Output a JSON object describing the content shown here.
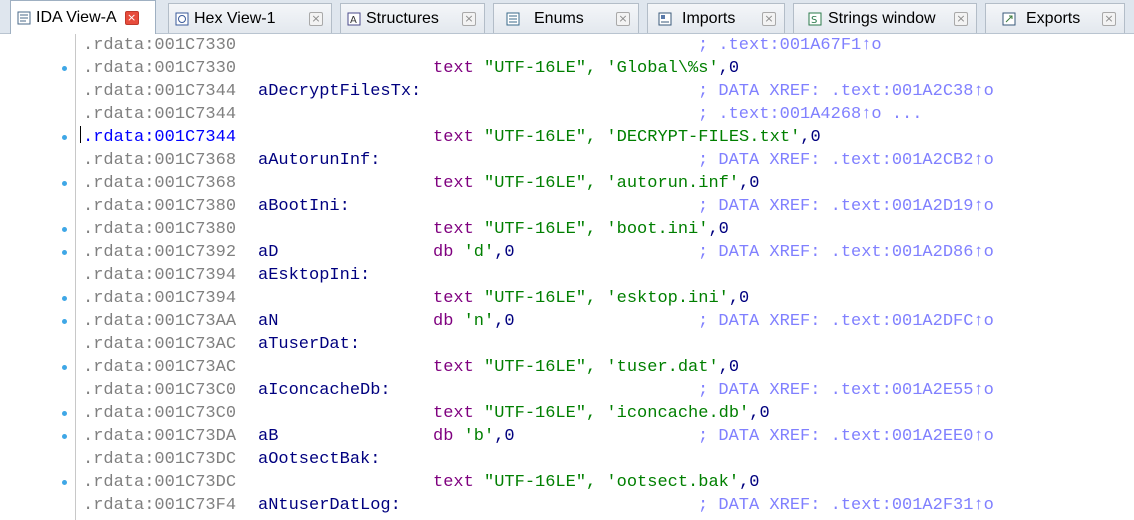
{
  "tabs": [
    {
      "label": "IDA View-A",
      "icon": "ida-view-icon",
      "active": true
    },
    {
      "label": "Hex View-1",
      "icon": "hex-view-icon",
      "active": false
    },
    {
      "label": "Structures",
      "icon": "structures-icon",
      "active": false
    },
    {
      "label": "Enums",
      "icon": "enums-icon",
      "active": false
    },
    {
      "label": "Imports",
      "icon": "imports-icon",
      "active": false
    },
    {
      "label": "Strings window",
      "icon": "strings-icon",
      "active": false
    },
    {
      "label": "Exports",
      "icon": "exports-icon",
      "active": false
    }
  ],
  "close_glyph": "×",
  "colors": {
    "address": "#808080",
    "current_address": "#0000ff",
    "name": "#00007f",
    "mnemonic": "#7f007f",
    "string": "#007f00",
    "comment": "#8080ff",
    "breakpoint_dot": "#3fa7e6"
  },
  "lines": [
    {
      "addr": ".rdata:001C7330",
      "name": "",
      "mnem": "",
      "str": "",
      "tail": "",
      "comment": "; .text:001A67F1↑o",
      "dot": false
    },
    {
      "addr": ".rdata:001C7330",
      "name": "",
      "mnem": "text ",
      "str": "\"UTF-16LE\", 'Global\\%s'",
      "tail": ",0",
      "comment": "",
      "dot": true
    },
    {
      "addr": ".rdata:001C7344",
      "name": "aDecryptFilesTx:",
      "mnem": "",
      "str": "",
      "tail": "",
      "comment": "; DATA XREF: .text:001A2C38↑o",
      "dot": false
    },
    {
      "addr": ".rdata:001C7344",
      "name": "",
      "mnem": "",
      "str": "",
      "tail": "",
      "comment": "; .text:001A4268↑o ...",
      "dot": false
    },
    {
      "addr": ".rdata:001C7344",
      "name": "",
      "mnem": "text ",
      "str": "\"UTF-16LE\", 'DECRYPT-FILES.txt'",
      "tail": ",0",
      "comment": "",
      "dot": true,
      "current": true
    },
    {
      "addr": ".rdata:001C7368",
      "name": "aAutorunInf:",
      "mnem": "",
      "str": "",
      "tail": "",
      "comment": "; DATA XREF: .text:001A2CB2↑o",
      "dot": false
    },
    {
      "addr": ".rdata:001C7368",
      "name": "",
      "mnem": "text ",
      "str": "\"UTF-16LE\", 'autorun.inf'",
      "tail": ",0",
      "comment": "",
      "dot": true
    },
    {
      "addr": ".rdata:001C7380",
      "name": "aBootIni:",
      "mnem": "",
      "str": "",
      "tail": "",
      "comment": "; DATA XREF: .text:001A2D19↑o",
      "dot": false
    },
    {
      "addr": ".rdata:001C7380",
      "name": "",
      "mnem": "text ",
      "str": "\"UTF-16LE\", 'boot.ini'",
      "tail": ",0",
      "comment": "",
      "dot": true
    },
    {
      "addr": ".rdata:001C7392",
      "name": "aD",
      "mnem": "db ",
      "str": "'d'",
      "tail": ",0",
      "comment": "; DATA XREF: .text:001A2D86↑o",
      "dot": true
    },
    {
      "addr": ".rdata:001C7394",
      "name": "aEsktopIni:",
      "mnem": "",
      "str": "",
      "tail": "",
      "comment": "",
      "dot": false
    },
    {
      "addr": ".rdata:001C7394",
      "name": "",
      "mnem": "text ",
      "str": "\"UTF-16LE\", 'esktop.ini'",
      "tail": ",0",
      "comment": "",
      "dot": true
    },
    {
      "addr": ".rdata:001C73AA",
      "name": "aN",
      "mnem": "db ",
      "str": "'n'",
      "tail": ",0",
      "comment": "; DATA XREF: .text:001A2DFC↑o",
      "dot": true
    },
    {
      "addr": ".rdata:001C73AC",
      "name": "aTuserDat:",
      "mnem": "",
      "str": "",
      "tail": "",
      "comment": "",
      "dot": false
    },
    {
      "addr": ".rdata:001C73AC",
      "name": "",
      "mnem": "text ",
      "str": "\"UTF-16LE\", 'tuser.dat'",
      "tail": ",0",
      "comment": "",
      "dot": true
    },
    {
      "addr": ".rdata:001C73C0",
      "name": "aIconcacheDb:",
      "mnem": "",
      "str": "",
      "tail": "",
      "comment": "; DATA XREF: .text:001A2E55↑o",
      "dot": false
    },
    {
      "addr": ".rdata:001C73C0",
      "name": "",
      "mnem": "text ",
      "str": "\"UTF-16LE\", 'iconcache.db'",
      "tail": ",0",
      "comment": "",
      "dot": true
    },
    {
      "addr": ".rdata:001C73DA",
      "name": "aB",
      "mnem": "db ",
      "str": "'b'",
      "tail": ",0",
      "comment": "; DATA XREF: .text:001A2EE0↑o",
      "dot": true
    },
    {
      "addr": ".rdata:001C73DC",
      "name": "aOotsectBak:",
      "mnem": "",
      "str": "",
      "tail": "",
      "comment": "",
      "dot": false
    },
    {
      "addr": ".rdata:001C73DC",
      "name": "",
      "mnem": "text ",
      "str": "\"UTF-16LE\", 'ootsect.bak'",
      "tail": ",0",
      "comment": "",
      "dot": true
    },
    {
      "addr": ".rdata:001C73F4",
      "name": "aNtuserDatLog:",
      "mnem": "",
      "str": "",
      "tail": "",
      "comment": "; DATA XREF: .text:001A2F31↑o",
      "dot": false
    }
  ]
}
